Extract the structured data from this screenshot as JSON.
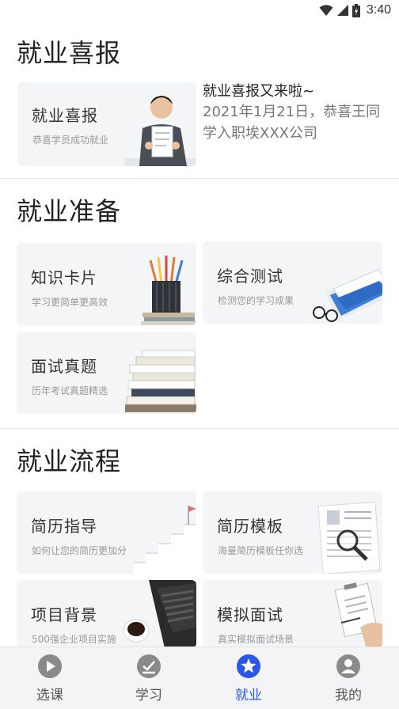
{
  "status_bar": {
    "time": "3:40"
  },
  "sections": {
    "report": {
      "title": "就业喜报"
    },
    "prep": {
      "title": "就业准备"
    },
    "flow": {
      "title": "就业流程"
    }
  },
  "report_card": {
    "title": "就业喜报",
    "subtitle": "恭喜学员成功就业"
  },
  "news": {
    "headline": "就业喜报又来啦~",
    "body": "2021年1月21日，恭喜王同学入职埃XXX公司"
  },
  "prep_cards": [
    {
      "title": "知识卡片",
      "subtitle": "学习更简单更高效"
    },
    {
      "title": "综合测试",
      "subtitle": "检测您的学习成果"
    },
    {
      "title": "面试真题",
      "subtitle": "历年考试真题精选"
    }
  ],
  "flow_cards": [
    {
      "title": "简历指导",
      "subtitle": "如何让您的简历更加分"
    },
    {
      "title": "简历模板",
      "subtitle": "海量简历模板任你选"
    },
    {
      "title": "项目背景",
      "subtitle": "500强企业项目实施"
    },
    {
      "title": "模拟面试",
      "subtitle": "真实模拟面试场景"
    }
  ],
  "bottom_nav": [
    {
      "label": "选课",
      "icon": "play-icon"
    },
    {
      "label": "学习",
      "icon": "study-check-icon"
    },
    {
      "label": "就业",
      "icon": "star-icon",
      "active": true
    },
    {
      "label": "我的",
      "icon": "profile-icon"
    }
  ],
  "colors": {
    "accent": "#2a57e6",
    "card_bg": "#f4f5f7",
    "nav_inactive": "#555555"
  }
}
